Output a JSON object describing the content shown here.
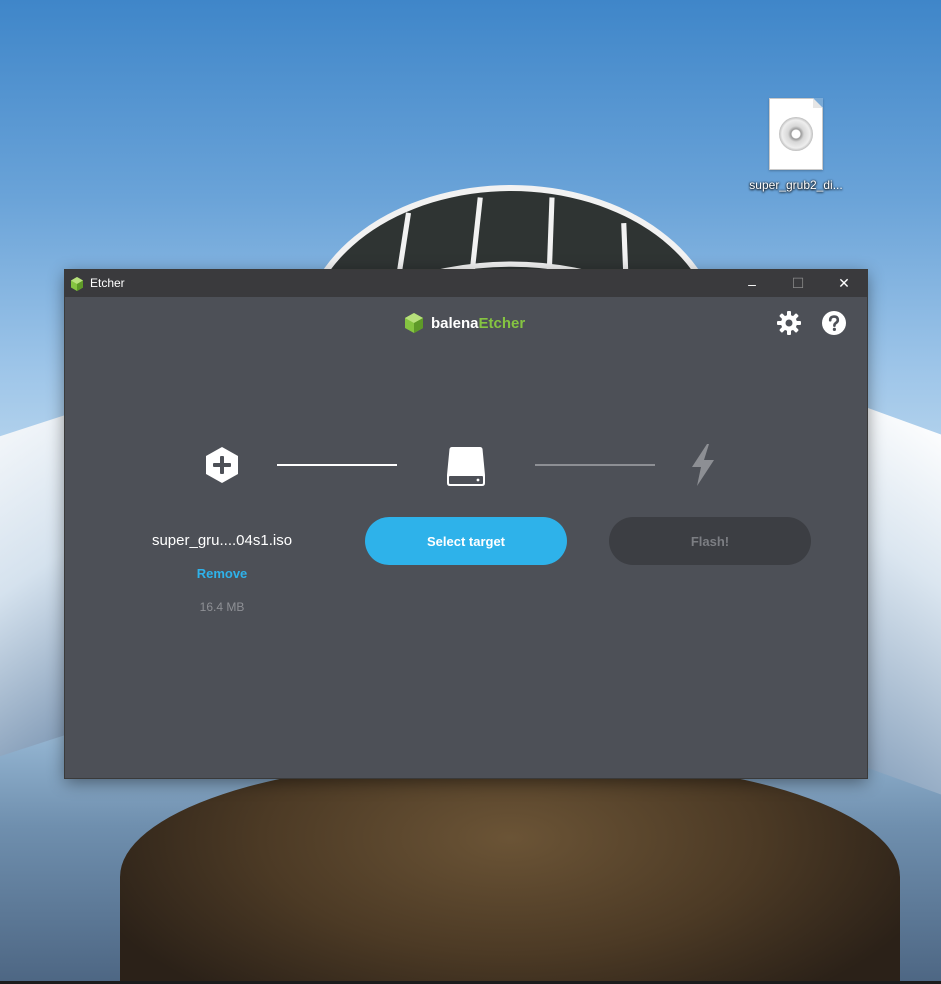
{
  "desktop": {
    "icon": {
      "label": "super_grub2_di...",
      "icon": "disc-image-file-icon"
    }
  },
  "window": {
    "title": "Etcher",
    "controls": {
      "minimize": "–",
      "maximize": "☐",
      "close": "✕"
    }
  },
  "header": {
    "logo_part1": "balena",
    "logo_part2": "Etcher",
    "settings_icon": "gear-icon",
    "help_icon": "help-icon"
  },
  "steps": {
    "image": {
      "icon": "plus-hexagon-icon",
      "name": "super_gru....04s1.iso",
      "remove_label": "Remove",
      "size": "16.4 MB"
    },
    "target": {
      "icon": "drive-icon",
      "button_label": "Select target"
    },
    "flash": {
      "icon": "lightning-icon",
      "button_label": "Flash!"
    }
  },
  "colors": {
    "accent": "#2eb2ea",
    "brand_green": "#85c441",
    "background": "#4d5057",
    "titlebar": "#3a3a3d",
    "disabled_button": "#3c3e43"
  }
}
